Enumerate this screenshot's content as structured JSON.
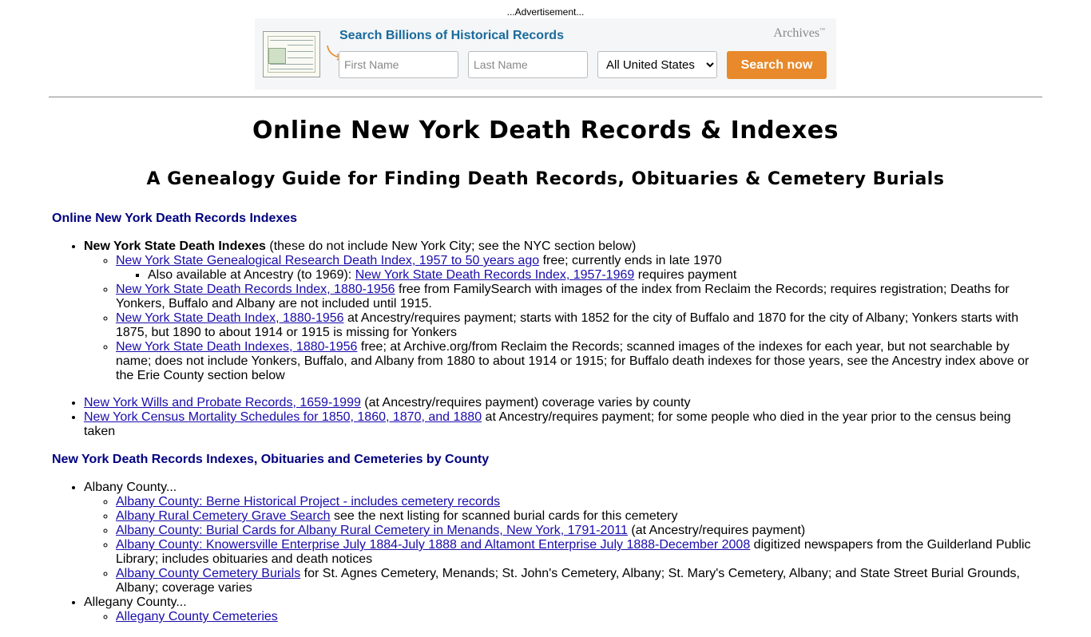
{
  "ad": {
    "label": "...Advertisement...",
    "title": "Search Billions of Historical Records",
    "brand": "Archives",
    "first_name_placeholder": "First Name",
    "last_name_placeholder": "Last Name",
    "region_selected": "All United States",
    "search_button": "Search now"
  },
  "page": {
    "title": "Online New York Death Records & Indexes",
    "subtitle": "A Genealogy Guide for Finding Death Records, Obituaries & Cemetery Burials"
  },
  "section1": {
    "heading": "Online New York Death Records Indexes",
    "state_title": "New York State Death Indexes",
    "state_note": " (these do not include New York City; see the NYC section below)",
    "items": [
      {
        "link": "New York State Genealogical Research Death Index, 1957 to 50 years ago",
        "text": " free; currently ends in late 1970"
      },
      {
        "link": "New York State Death Records Index, 1880-1956",
        "text": " free from FamilySearch with images of the index from Reclaim the Records; requires registration; Deaths for Yonkers, Buffalo and Albany are not included until 1915."
      },
      {
        "link": "New York State Death Index, 1880-1956",
        "text": " at Ancestry/requires payment; starts with 1852 for the city of Buffalo and 1870 for the city of Albany; Yonkers starts with 1875, but 1890 to about 1914 or 1915 is missing for Yonkers"
      },
      {
        "link": "New York State Death Indexes, 1880-1956",
        "text": " free; at Archive.org/from Reclaim the Records; scanned images of the indexes for each year, but not searchable by name; does not include Yonkers, Buffalo, and Albany from 1880 to about 1914 or 1915; for Buffalo death indexes for those years, see the Ancestry index above or the Erie County section below"
      }
    ],
    "sub_item": {
      "prefix": "Also available at Ancestry (to 1969): ",
      "link": "New York State Death Records Index, 1957-1969",
      "text": " requires payment"
    },
    "wills": {
      "link": "New York Wills and Probate Records, 1659-1999",
      "text": " (at Ancestry/requires payment) coverage varies by county"
    },
    "census": {
      "link": "New York Census Mortality Schedules for 1850, 1860, 1870, and 1880",
      "text": " at Ancestry/requires payment; for some people who died in the year prior to the census being taken"
    }
  },
  "section2": {
    "heading": "New York Death Records Indexes, Obituaries and Cemeteries by County",
    "albany_label": "Albany County...",
    "albany_items": [
      {
        "link": "Albany County: Berne Historical Project - includes cemetery records",
        "text": ""
      },
      {
        "link": "Albany Rural Cemetery Grave Search",
        "text": " see the next listing for scanned burial cards for this cemetery"
      },
      {
        "link": "Albany County: Burial Cards for Albany Rural Cemetery in Menands, New York, 1791-2011",
        "text": " (at Ancestry/requires payment)"
      },
      {
        "link": "Albany County: Knowersville Enterprise July 1884-July 1888 and Altamont Enterprise July 1888-December 2008",
        "text": " digitized newspapers from the Guilderland Public Library; includes obituaries and death notices"
      },
      {
        "link": "Albany County Cemetery Burials",
        "text": " for St. Agnes Cemetery, Menands; St. John's Cemetery, Albany; St. Mary's Cemetery, Albany; and State Street Burial Grounds, Albany; coverage varies"
      }
    ],
    "allegany_label": "Allegany County...",
    "allegany_items": [
      {
        "link": "Allegany County Cemeteries",
        "text": ""
      }
    ]
  }
}
